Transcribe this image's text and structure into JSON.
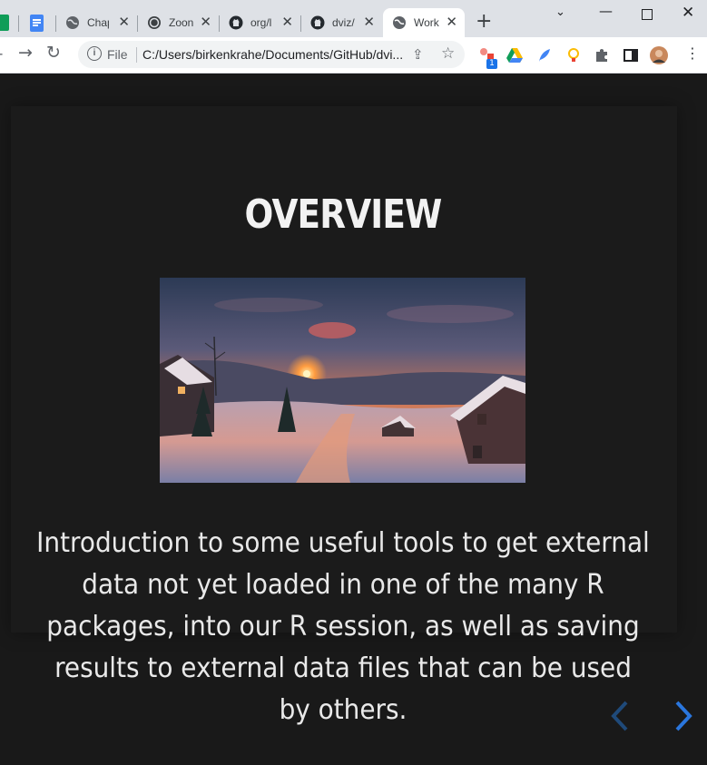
{
  "browser": {
    "tabs": [
      {
        "label": "Chap",
        "icon": "globe-icon"
      },
      {
        "label": "Zoon",
        "icon": "zoom-icon"
      },
      {
        "label": "org/l",
        "icon": "github-icon"
      },
      {
        "label": "dviz/",
        "icon": "github-icon"
      },
      {
        "label": "Work",
        "icon": "globe-icon",
        "active": true
      }
    ],
    "new_tab_label": "+",
    "omnibox": {
      "scheme_label": "File",
      "url": "C:/Users/birkenkrahe/Documents/GitHub/dvi..."
    },
    "extension_badge": "1"
  },
  "slide": {
    "title": "OVERVIEW",
    "image_alt": "sunset over snowy mountain village",
    "body": "Introduction to some useful tools to get external data not yet loaded in one of the many R packages, into our R session, as well as saving results to external data files that can be used by others."
  },
  "colors": {
    "background": "#191919",
    "slide_bg": "#1b1b1b",
    "title": "#f2f2f2",
    "text": "#e9e9e9",
    "nav_next": "#2a76dd",
    "nav_prev": "#1f4a7a"
  }
}
